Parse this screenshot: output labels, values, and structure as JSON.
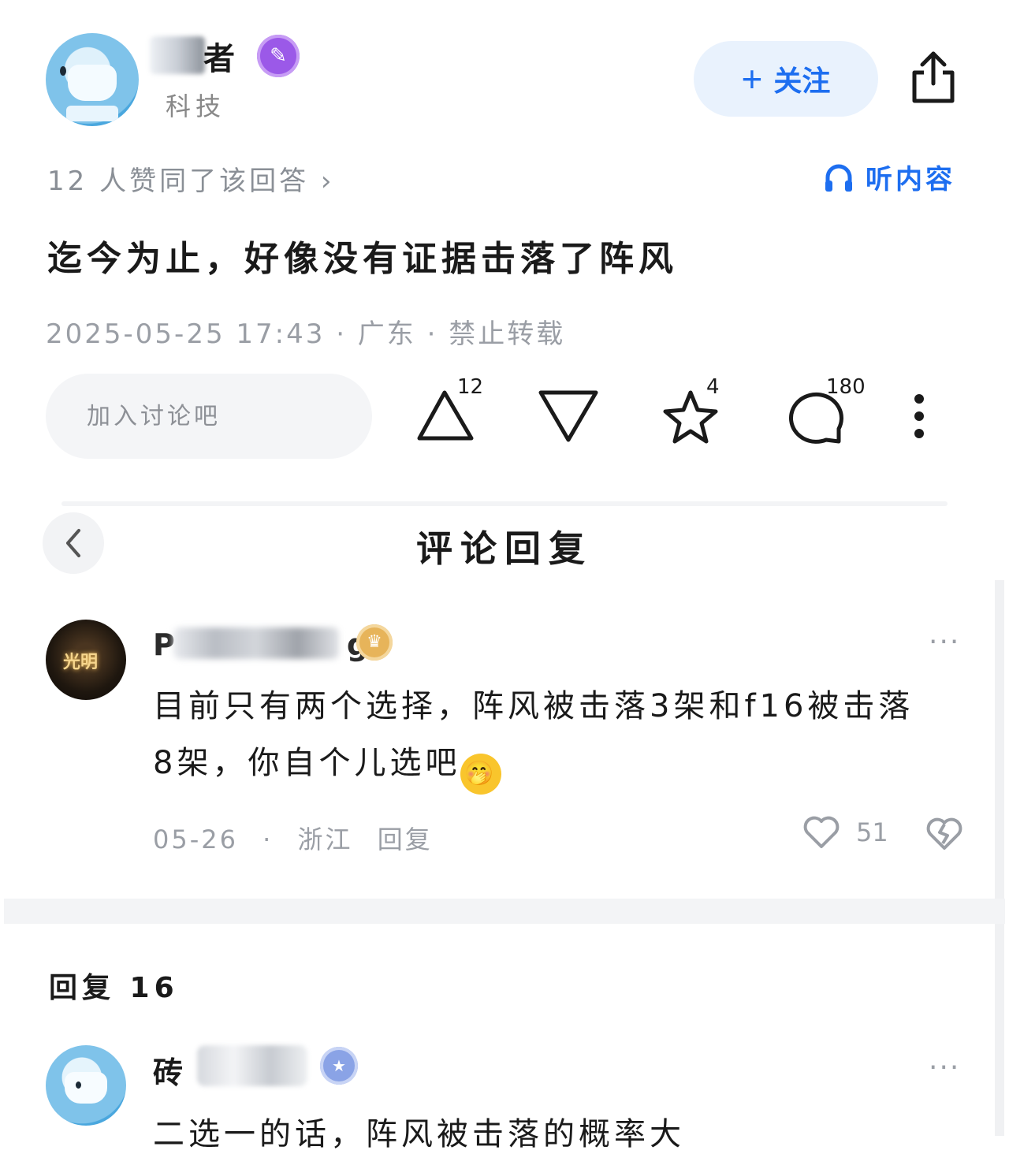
{
  "header": {
    "author_name": "者",
    "author_category": "科技",
    "follow_label": "关注",
    "follow_plus": "+",
    "share_icon": "share-icon"
  },
  "answer": {
    "agree_text": "12 人赞同了该回答 ›",
    "listen_label": "听内容",
    "text": "迄今为止，好像没有证据击落了阵风",
    "meta": "2025-05-25 17:43 · 广东 · 禁止转载"
  },
  "actions": {
    "discuss_placeholder": "加入讨论吧",
    "upvote_count": "12",
    "star_count": "4",
    "comment_count": "180"
  },
  "panel": {
    "title": "评论回复"
  },
  "comment": {
    "name_prefix": "P",
    "name_suffix": "g",
    "text_line1": "目前只有两个选择，阵风被击落3架和f16被击落",
    "text_line2": "8架，你自个儿选吧",
    "date": "05-26",
    "location": "浙江",
    "reply_label": "回复",
    "likes": "51",
    "more": "···"
  },
  "replies": {
    "label": "回复 16"
  },
  "reply_item": {
    "name_prefix": "砖",
    "text": "二选一的话，阵风被击落的概率大",
    "more": "···"
  },
  "colors": {
    "accent": "#1d6ef0",
    "muted": "#9a9ea5"
  }
}
